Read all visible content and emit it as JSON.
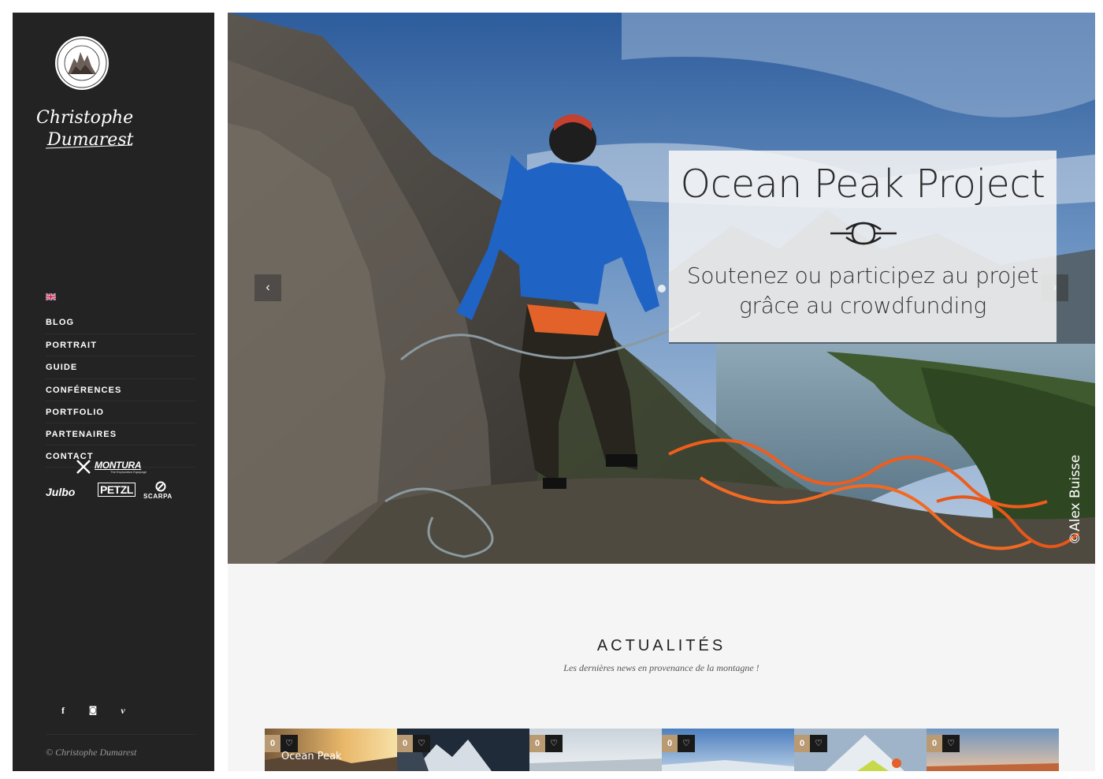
{
  "brand": {
    "badge_text": "ALPINISTE · GUIDE DE HAUTE MONTAGNE",
    "name_line1": "Christophe",
    "name_line2": "Dumarest"
  },
  "nav": {
    "language": "English",
    "items": [
      {
        "label": "BLOG"
      },
      {
        "label": "PORTRAIT"
      },
      {
        "label": "GUIDE"
      },
      {
        "label": "CONFÉRENCES"
      },
      {
        "label": "PORTFOLIO"
      },
      {
        "label": "PARTENAIRES"
      },
      {
        "label": "CONTACT"
      }
    ]
  },
  "sponsors": {
    "montura": "MONTURA",
    "montura_tag": "The Exploration Equipage",
    "julbo": "Julbo",
    "petzl": "PETZL",
    "scarpa": "SCARPA"
  },
  "social": {
    "facebook": "f",
    "instagram": "◙",
    "vimeo": "v"
  },
  "footer": {
    "copyright": "© Christophe Dumarest"
  },
  "hero": {
    "title": "Ocean Peak Project",
    "subtitle_line1": "Soutenez ou participez au projet",
    "subtitle_line2": "grâce au crowdfunding",
    "credit": "©Alex Buisse",
    "prev_label": "‹",
    "next_label": "›",
    "icon": "rope-knot-icon"
  },
  "news": {
    "title": "ACTUALITÉS",
    "subtitle": "Les dernières news en provenance de la montagne !",
    "cards": [
      {
        "count": "0",
        "like": "♡",
        "caption": "Ocean Peak"
      },
      {
        "count": "0",
        "like": "♡",
        "caption": ""
      },
      {
        "count": "0",
        "like": "♡",
        "caption": ""
      },
      {
        "count": "0",
        "like": "♡",
        "caption": ""
      },
      {
        "count": "0",
        "like": "♡",
        "caption": ""
      },
      {
        "count": "0",
        "like": "♡",
        "caption": ""
      }
    ]
  }
}
